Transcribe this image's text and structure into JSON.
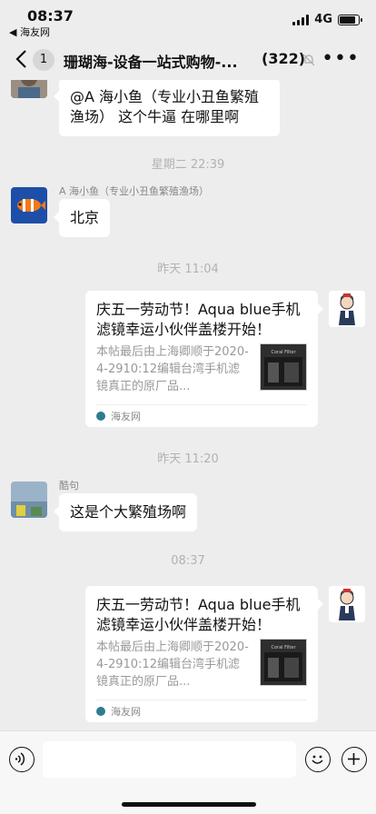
{
  "status_bar": {
    "time": "08:37",
    "back_app": "◀ 海友网",
    "network": "4G"
  },
  "nav": {
    "back_count": "1",
    "title": "珊瑚海-设备一站式购物-...",
    "member_count": "(322)",
    "more": "•••"
  },
  "messages": {
    "m1_text": "@A 海小鱼（专业小丑鱼繁殖渔场）  这个牛逼 在哪里啊",
    "ts1": "星期二 22:39",
    "m2_sender": "A 海小鱼（专业小丑鱼繁殖渔场）",
    "m2_text": "北京",
    "ts2": "昨天 11:04",
    "card1": {
      "title": "庆五一劳动节！Aqua blue手机滤镜幸运小伙伴盖楼开始！",
      "desc": "本帖最后由上海卿顺于2020-4-2910:12编辑台湾手机滤镜真正的原厂品...",
      "thumb_label": "Coral Filter",
      "source": "海友网"
    },
    "ts3": "昨天 11:20",
    "m3_sender": "酷句",
    "m3_text": "这是个大繁殖场啊",
    "ts4": "08:37",
    "card2": {
      "title": "庆五一劳动节！Aqua blue手机滤镜幸运小伙伴盖楼开始！",
      "desc": "本帖最后由上海卿顺于2020-4-2910:12编辑台湾手机滤镜真正的原厂品...",
      "thumb_label": "Coral Filter",
      "source": "海友网"
    }
  },
  "colors": {
    "background": "#ededed",
    "bubble": "#ffffff",
    "timestamp": "#b2b2b2"
  }
}
